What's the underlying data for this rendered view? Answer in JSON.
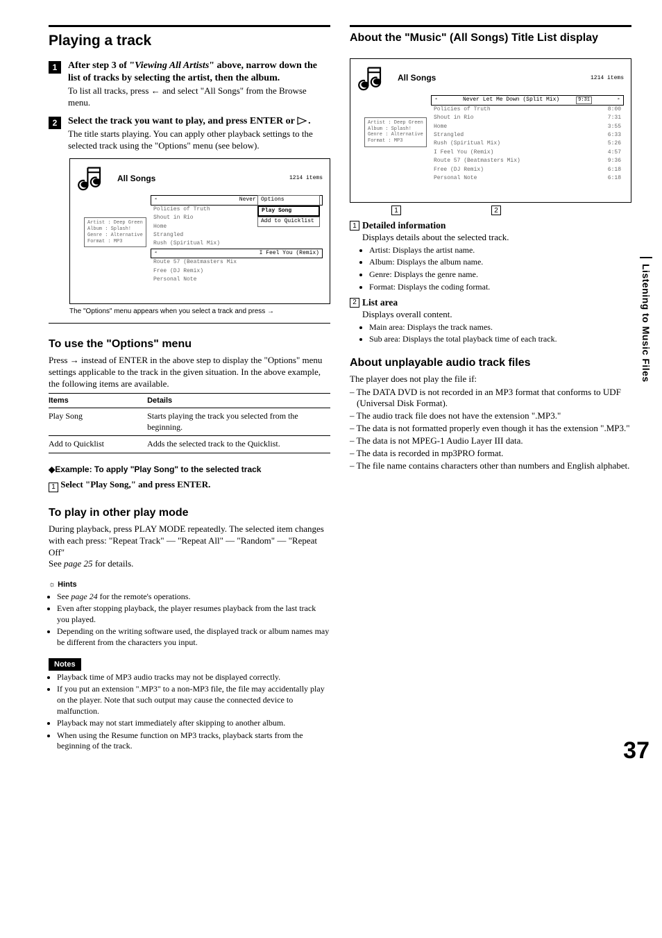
{
  "left": {
    "title": "Playing a track",
    "step1": {
      "num": "1",
      "head_pre": "After step 3 of \"",
      "head_em": "Viewing All Artists",
      "head_post": "\" above, narrow down the list of tracks by selecting the artist, then the album.",
      "text_pre": "To list all tracks, press ",
      "text_post": " and select \"All Songs\" from the Browse menu."
    },
    "step2": {
      "num": "2",
      "head_pre": "Select the track you want to play, and press ENTER or ",
      "head_post": ".",
      "text": "The title starts playing. You can apply other playback settings to the selected track using the \"Options\" menu (see below)."
    },
    "ui": {
      "all_songs": "All Songs",
      "items": "1214 items",
      "detail": {
        "artist": "Artist : Deep Green",
        "album": "Album  : Splash!",
        "genre": "Genre  : Alternative",
        "format": "Format : MP3"
      },
      "list": [
        {
          "name": "Never Let Me Down (Split",
          "dur": ""
        },
        {
          "name": "Policies of Truth",
          "dur": ""
        },
        {
          "name": "Shout in Rio",
          "dur": ""
        },
        {
          "name": "Home",
          "dur": ""
        },
        {
          "name": "Strangled",
          "dur": ""
        },
        {
          "name": "Rush (Spiritual Mix)",
          "dur": ""
        },
        {
          "name": "I Feel You (Remix)",
          "dur": ""
        },
        {
          "name": "Route 57 (Beatmasters Mix",
          "dur": ""
        },
        {
          "name": "Free (DJ Remix)",
          "dur": ""
        },
        {
          "name": "Personal Note",
          "dur": ""
        }
      ],
      "options_title": "Options",
      "options": [
        "Play Song",
        "Add to Quicklist"
      ]
    },
    "caption": "The \"Options\" menu appears when you select a track and press ",
    "options_heading": "To use the \"Options\" menu",
    "options_text_pre": "Press ",
    "options_text_post": " instead of ENTER in the above step to display the \"Options\" menu settings applicable to the track in the given situation. In the above example, the following items are available.",
    "table": {
      "h1": "Items",
      "h2": "Details",
      "r1c1": "Play Song",
      "r1c2": "Starts playing the track you selected from the beginning.",
      "r2c1": "Add to Quicklist",
      "r2c2": "Adds the selected track to the Quicklist."
    },
    "example_head": "Example: To apply \"Play Song\" to the selected track",
    "example_step": "Select \"Play Song,\" and press ENTER.",
    "play_mode_heading": "To play in other play mode",
    "play_mode_text": "During playback, press PLAY MODE repeatedly. The selected item changes with each press: \"Repeat Track\" — \"Repeat All\" — \"Random\" — \"Repeat Off\"",
    "play_mode_see_pre": "See ",
    "play_mode_see_em": "page 25",
    "play_mode_see_post": " for details.",
    "hints_label": "Hints",
    "hints": [
      {
        "pre": "See ",
        "em": "page 24",
        "post": " for the remote's operations."
      },
      {
        "txt": "Even after stopping playback, the player resumes playback from the last track you played."
      },
      {
        "txt": "Depending on the writing software used, the displayed track or album names may be different from the characters you input."
      }
    ],
    "notes_label": "Notes",
    "notes": [
      "Playback time of MP3 audio tracks may not be displayed correctly.",
      "If you put an extension \".MP3\" to a non-MP3 file, the file may accidentally play on the player. Note that such output may cause the connected device to malfunction.",
      "Playback may not start immediately after skipping to another album.",
      "When using the Resume function on MP3 tracks, playback starts from the beginning of the track."
    ]
  },
  "right": {
    "title": "About the \"Music\" (All Songs) Title List display",
    "ui": {
      "all_songs": "All Songs",
      "items": "1214 items",
      "detail": {
        "artist": "Artist : Deep Green",
        "album": "Album  : Splash!",
        "genre": "Genre  : Alternative",
        "format": "Format : MP3"
      },
      "list": [
        {
          "name": "Never Let Me Down (Split Mix)",
          "dur": "9:31"
        },
        {
          "name": "Policies of Truth",
          "dur": "8:00"
        },
        {
          "name": "Shout in Rio",
          "dur": "7:31"
        },
        {
          "name": "Home",
          "dur": "3:55"
        },
        {
          "name": "Strangled",
          "dur": "6:33"
        },
        {
          "name": "Rush (Spiritual Mix)",
          "dur": "5:26"
        },
        {
          "name": "I Feel You (Remix)",
          "dur": "4:57"
        },
        {
          "name": "Route 57 (Beatmasters Mix)",
          "dur": "9:36"
        },
        {
          "name": "Free (DJ Remix)",
          "dur": "6:18"
        },
        {
          "name": "Personal Note",
          "dur": "6:18"
        }
      ]
    },
    "c1": "1",
    "c2": "2",
    "d1_label": "Detailed information",
    "d1_text": "Displays details about the selected track.",
    "d1_items": [
      "Artist: Displays the artist name.",
      "Album: Displays the album name.",
      "Genre: Displays the genre name.",
      "Format: Displays the coding format."
    ],
    "d2_label": "List area",
    "d2_text": "Displays overall content.",
    "d2_items": [
      "Main area: Displays the track names.",
      "Sub area: Displays the total playback time of each track."
    ],
    "unplay_heading": "About unplayable audio track files",
    "unplay_intro": "The player does not play the file if:",
    "unplay_items": [
      "The DATA DVD is not recorded in an MP3 format that conforms to UDF (Universal Disk Format).",
      "The audio track file does not have the extension \".MP3.\"",
      "The data is not formatted properly even though it has the extension \".MP3.\"",
      "The data is not MPEG-1 Audio Layer III data.",
      "The data is recorded in mp3PRO format.",
      "The file name contains characters other than numbers and English alphabet."
    ]
  },
  "side_tab": "Listening to Music Files",
  "page_number": "37"
}
